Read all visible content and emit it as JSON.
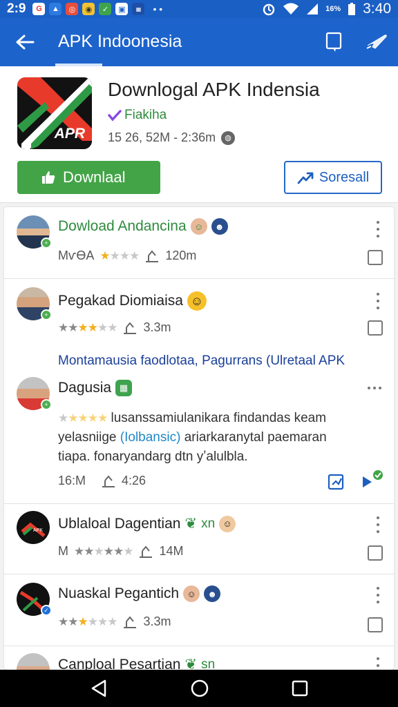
{
  "status_bar": {
    "time_left": "2:9",
    "battery_text": "16%",
    "time_right": "3:40"
  },
  "app_bar": {
    "title": "APK Indoonesia"
  },
  "app": {
    "title": "Downlogal APK Indensia",
    "developer": "Fiakiha",
    "meta": "15 26, 52Μ - 2:36m",
    "logo_text": "APR",
    "download_label": "Downlaal",
    "share_label": "Soresall"
  },
  "items": [
    {
      "name": "Dowload Andancina",
      "rating_prefix": "MѵӨA",
      "count": "120m"
    },
    {
      "name": "Pegakad Diomiaisa",
      "rating_prefix": "",
      "count": "3.3m"
    },
    {
      "name": "Ublaloal Dagentian",
      "name_suffix": "xn",
      "rating_prefix": "M",
      "count": "14M"
    },
    {
      "name": "Nuaskal Pegantich",
      "rating_prefix": "",
      "count": "3.3m"
    },
    {
      "name": "Canploal Pesartian",
      "name_suffix": "sn"
    }
  ],
  "section": {
    "heading": "Montamausia faodlotaa, Pagurrans (Ulretaal APK"
  },
  "featured": {
    "name": "Dagusia",
    "review_line1": "lusanssamiulanikara findandas keam",
    "review_line2_a": "yelasniige",
    "review_line2_hl": "(Iolbansic)",
    "review_line2_b": "ariarkaranytal paemaran",
    "review_line3": "tiapa. fonaryandarg dtn yʼalulbla.",
    "size": "16:M",
    "count": "4:26"
  },
  "colors": {
    "primary": "#1d63cc",
    "download_green": "#43a447",
    "star": "#f2b01e",
    "dev_green": "#2e8b3d"
  }
}
